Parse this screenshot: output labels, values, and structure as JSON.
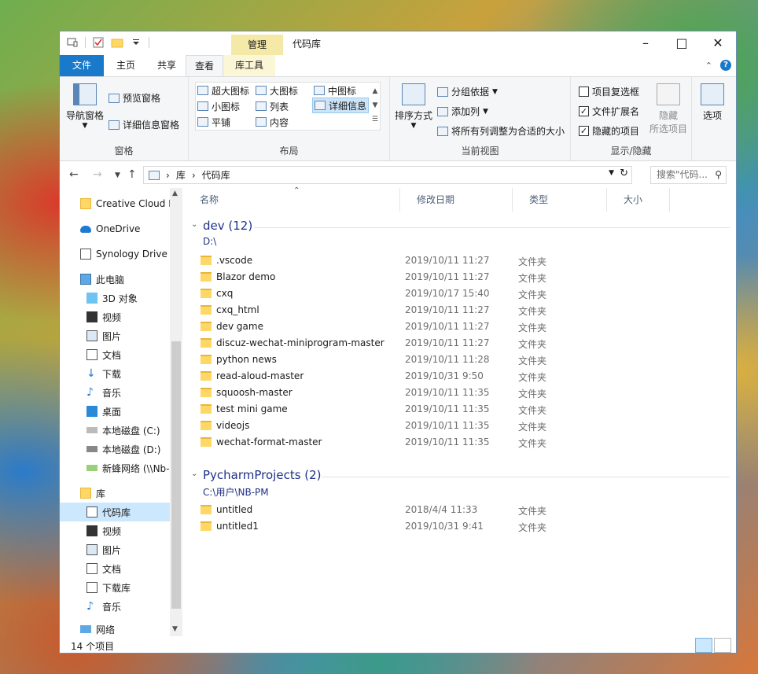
{
  "window": {
    "title": "代码库",
    "context_tab": "管理"
  },
  "tabs": [
    {
      "label": "文件"
    },
    {
      "label": "主页"
    },
    {
      "label": "共享"
    },
    {
      "label": "查看"
    },
    {
      "label": "库工具"
    }
  ],
  "ribbon": {
    "panes": {
      "nav_pane": "导航窗格",
      "preview_pane": "预览窗格",
      "details_pane": "详细信息窗格",
      "label": "窗格"
    },
    "layout": {
      "items": [
        "超大图标",
        "大图标",
        "中图标",
        "小图标",
        "列表",
        "详细信息",
        "平铺",
        "内容"
      ],
      "label": "布局"
    },
    "current_view": {
      "sort": "排序方式",
      "group_by": "分组依据",
      "add_column": "添加列",
      "fit_columns": "将所有列调整为合适的大小",
      "label": "当前视图"
    },
    "show_hide": {
      "item_checkboxes": "项目复选框",
      "file_extensions": "文件扩展名",
      "hidden_items": "隐藏的项目",
      "hide_selected_1": "隐藏",
      "hide_selected_2": "所选项目",
      "options": "选项",
      "label": "显示/隐藏"
    }
  },
  "address": {
    "crumbs": [
      "库",
      "代码库"
    ],
    "search_placeholder": "搜索\"代码..."
  },
  "nav": {
    "items": [
      {
        "label": "Creative Cloud F"
      },
      {
        "label": "OneDrive"
      },
      {
        "label": "Synology Drive -"
      },
      {
        "label": "此电脑"
      },
      {
        "label": "3D 对象"
      },
      {
        "label": "视频"
      },
      {
        "label": "图片"
      },
      {
        "label": "文档"
      },
      {
        "label": "下载"
      },
      {
        "label": "音乐"
      },
      {
        "label": "桌面"
      },
      {
        "label": "本地磁盘 (C:)"
      },
      {
        "label": "本地磁盘 (D:)"
      },
      {
        "label": "新蜂网络 (\\\\Nb-"
      },
      {
        "label": "库"
      },
      {
        "label": "代码库"
      },
      {
        "label": "视频"
      },
      {
        "label": "图片"
      },
      {
        "label": "文档"
      },
      {
        "label": "下载库"
      },
      {
        "label": "音乐"
      },
      {
        "label": "网络"
      }
    ]
  },
  "columns": {
    "name": "名称",
    "date": "修改日期",
    "type": "类型",
    "size": "大小"
  },
  "groups": [
    {
      "title": "dev (12)",
      "path": "D:\\",
      "rows": [
        {
          "name": ".vscode",
          "date": "2019/10/11 11:27",
          "type": "文件夹"
        },
        {
          "name": "Blazor demo",
          "date": "2019/10/11 11:27",
          "type": "文件夹"
        },
        {
          "name": "cxq",
          "date": "2019/10/17 15:40",
          "type": "文件夹"
        },
        {
          "name": "cxq_html",
          "date": "2019/10/11 11:27",
          "type": "文件夹"
        },
        {
          "name": "dev game",
          "date": "2019/10/11 11:27",
          "type": "文件夹"
        },
        {
          "name": "discuz-wechat-miniprogram-master",
          "date": "2019/10/11 11:27",
          "type": "文件夹"
        },
        {
          "name": "python news",
          "date": "2019/10/11 11:28",
          "type": "文件夹"
        },
        {
          "name": "read-aloud-master",
          "date": "2019/10/31 9:50",
          "type": "文件夹"
        },
        {
          "name": "squoosh-master",
          "date": "2019/10/11 11:35",
          "type": "文件夹"
        },
        {
          "name": "test mini game",
          "date": "2019/10/11 11:35",
          "type": "文件夹"
        },
        {
          "name": "videojs",
          "date": "2019/10/11 11:35",
          "type": "文件夹"
        },
        {
          "name": "wechat-format-master",
          "date": "2019/10/11 11:35",
          "type": "文件夹"
        }
      ]
    },
    {
      "title": "PycharmProjects (2)",
      "path": "C:\\用户\\NB-PM",
      "rows": [
        {
          "name": "untitled",
          "date": "2018/4/4 11:33",
          "type": "文件夹"
        },
        {
          "name": "untitled1",
          "date": "2019/10/31 9:41",
          "type": "文件夹"
        }
      ]
    }
  ],
  "status": {
    "count": "14 个项目"
  }
}
